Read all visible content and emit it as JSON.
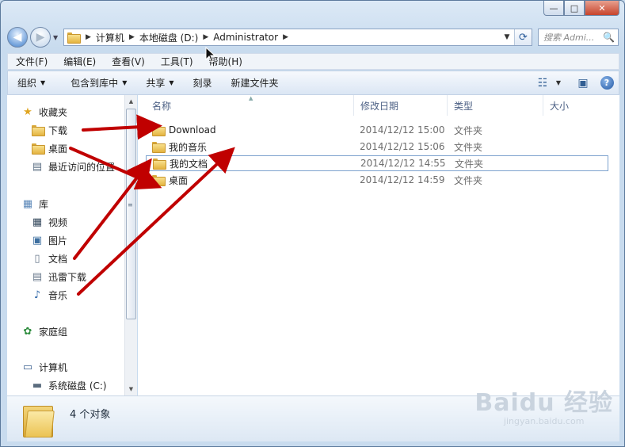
{
  "window": {
    "caption": {
      "minimize": "—",
      "maximize": "□",
      "close": "✕"
    }
  },
  "nav": {
    "back_icon": "back-arrow-icon",
    "forward_icon": "forward-arrow-icon"
  },
  "address": {
    "segments": [
      "计算机",
      "本地磁盘 (D:)",
      "Administrator"
    ],
    "sep": "▶"
  },
  "search": {
    "placeholder": "搜索 Admi...",
    "icon": "🔍"
  },
  "menubar": [
    "文件(F)",
    "编辑(E)",
    "查看(V)",
    "工具(T)",
    "帮助(H)"
  ],
  "cmdbar": {
    "organize": "组织",
    "include_library": "包含到库中",
    "share": "共享",
    "burn": "刻录",
    "new_folder": "新建文件夹"
  },
  "navpane": {
    "favorites": "收藏夹",
    "downloads": "下载",
    "desktop": "桌面",
    "recent": "最近访问的位置",
    "libraries": "库",
    "videos": "视频",
    "pictures": "图片",
    "documents": "文档",
    "xunlei": "迅雷下载",
    "music": "音乐",
    "homegroup": "家庭组",
    "computer": "计算机",
    "system_disk": "系统磁盘 (C:)"
  },
  "columns": {
    "name": "名称",
    "date": "修改日期",
    "type": "类型",
    "size": "大小"
  },
  "files": [
    {
      "name": "Download",
      "date": "2014/12/12 15:00",
      "type": "文件夹"
    },
    {
      "name": "我的音乐",
      "date": "2014/12/12 15:06",
      "type": "文件夹"
    },
    {
      "name": "我的文档",
      "date": "2014/12/12 14:55",
      "type": "文件夹"
    },
    {
      "name": "桌面",
      "date": "2014/12/12 14:59",
      "type": "文件夹"
    }
  ],
  "status": {
    "count": "4 个对象"
  },
  "watermark": {
    "line1": "Baidu 经验",
    "line2": "jingyan.baidu.com"
  },
  "colors": {
    "arrow": "#c00000",
    "accent": "#2c5d9b"
  }
}
